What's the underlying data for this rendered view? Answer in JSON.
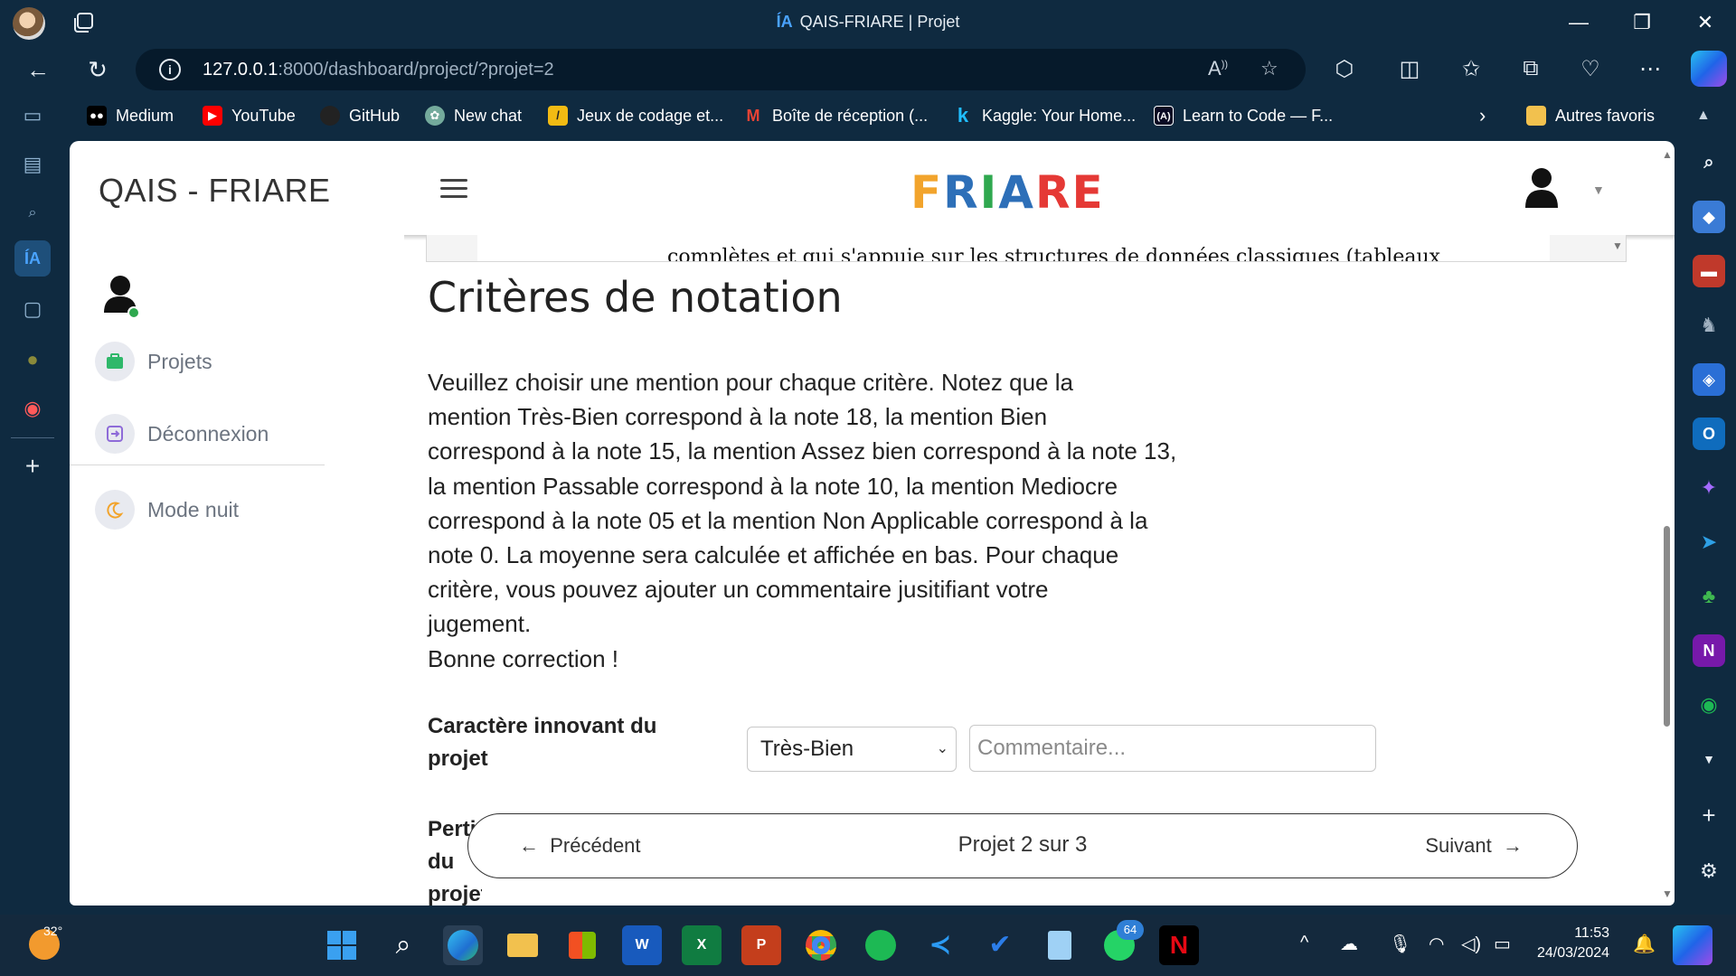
{
  "window": {
    "title": "QAIS-FRIARE | Projet",
    "min_glyph": "—",
    "restore_glyph": "❐",
    "close_glyph": "✕"
  },
  "address": {
    "host": "127.0.0.1",
    "path": ":8000/dashboard/project/?projet=2"
  },
  "favorites": [
    {
      "label": "Medium",
      "icon": "medium-icon",
      "color": "#000000"
    },
    {
      "label": "YouTube",
      "icon": "youtube-icon",
      "color": "#ff0000"
    },
    {
      "label": "GitHub",
      "icon": "github-icon",
      "color": "#222222"
    },
    {
      "label": "New chat",
      "icon": "openai-icon",
      "color": "#74aa9c"
    },
    {
      "label": "Jeux de codage et...",
      "icon": "codingame-icon",
      "color": "#f2bb13"
    },
    {
      "label": "Boîte de réception (...",
      "icon": "gmail-icon",
      "color": "#ea4335"
    },
    {
      "label": "Kaggle: Your Home...",
      "icon": "kaggle-icon",
      "color": "#20beff"
    },
    {
      "label": "Learn to Code — F...",
      "icon": "freecodecamp-icon",
      "color": "#0a0a23"
    }
  ],
  "favorites_other": "Autres favoris",
  "app": {
    "brand": "QAIS - FRIARE",
    "logo_letters": [
      "F",
      "R",
      "I",
      "A",
      "R",
      "E"
    ],
    "logo_colors": [
      "#f2a42c",
      "#2d6fb8",
      "#2fa84f",
      "#2d6fb8",
      "#e53935",
      "#e53935"
    ]
  },
  "pdf_preview_line": "complètes et qui s'appuie sur les structures de données classiques (tableaux",
  "sidebar": {
    "items": [
      {
        "label": "Projets",
        "icon": "briefcase-icon"
      },
      {
        "label": "Déconnexion",
        "icon": "logout-icon"
      },
      {
        "label": "Mode nuit",
        "icon": "moon-icon"
      }
    ]
  },
  "main": {
    "heading": "Critères de notation",
    "intro": "Veuillez choisir une mention pour chaque critère. Notez que la\nmention Très-Bien correspond à la note 18, la mention Bien\ncorrespond à la note 15, la mention Assez bien correspond à la note 13,\nla mention Passable correspond à la note 10, la mention Mediocre\ncorrespond à la note 05 et la mention Non Applicable correspond à la\nnote 0. La moyenne sera calculée et affichée en bas. Pour chaque\ncritère, vous pouvez ajouter un commentaire jusitifiant votre\njugement.\nBonne correction !",
    "criteria": [
      {
        "label": "Caractère innovant du projet",
        "selected": "Très-Bien",
        "comment_placeholder": "Commentaire..."
      },
      {
        "label": "Pertinence du projet"
      }
    ]
  },
  "pager": {
    "prev": "Précédent",
    "status": "Projet 2 sur 3",
    "next": "Suivant"
  },
  "taskbar": {
    "temperature": "32°",
    "whatsapp_badge": "64",
    "time": "11:53",
    "date": "24/03/2024"
  }
}
